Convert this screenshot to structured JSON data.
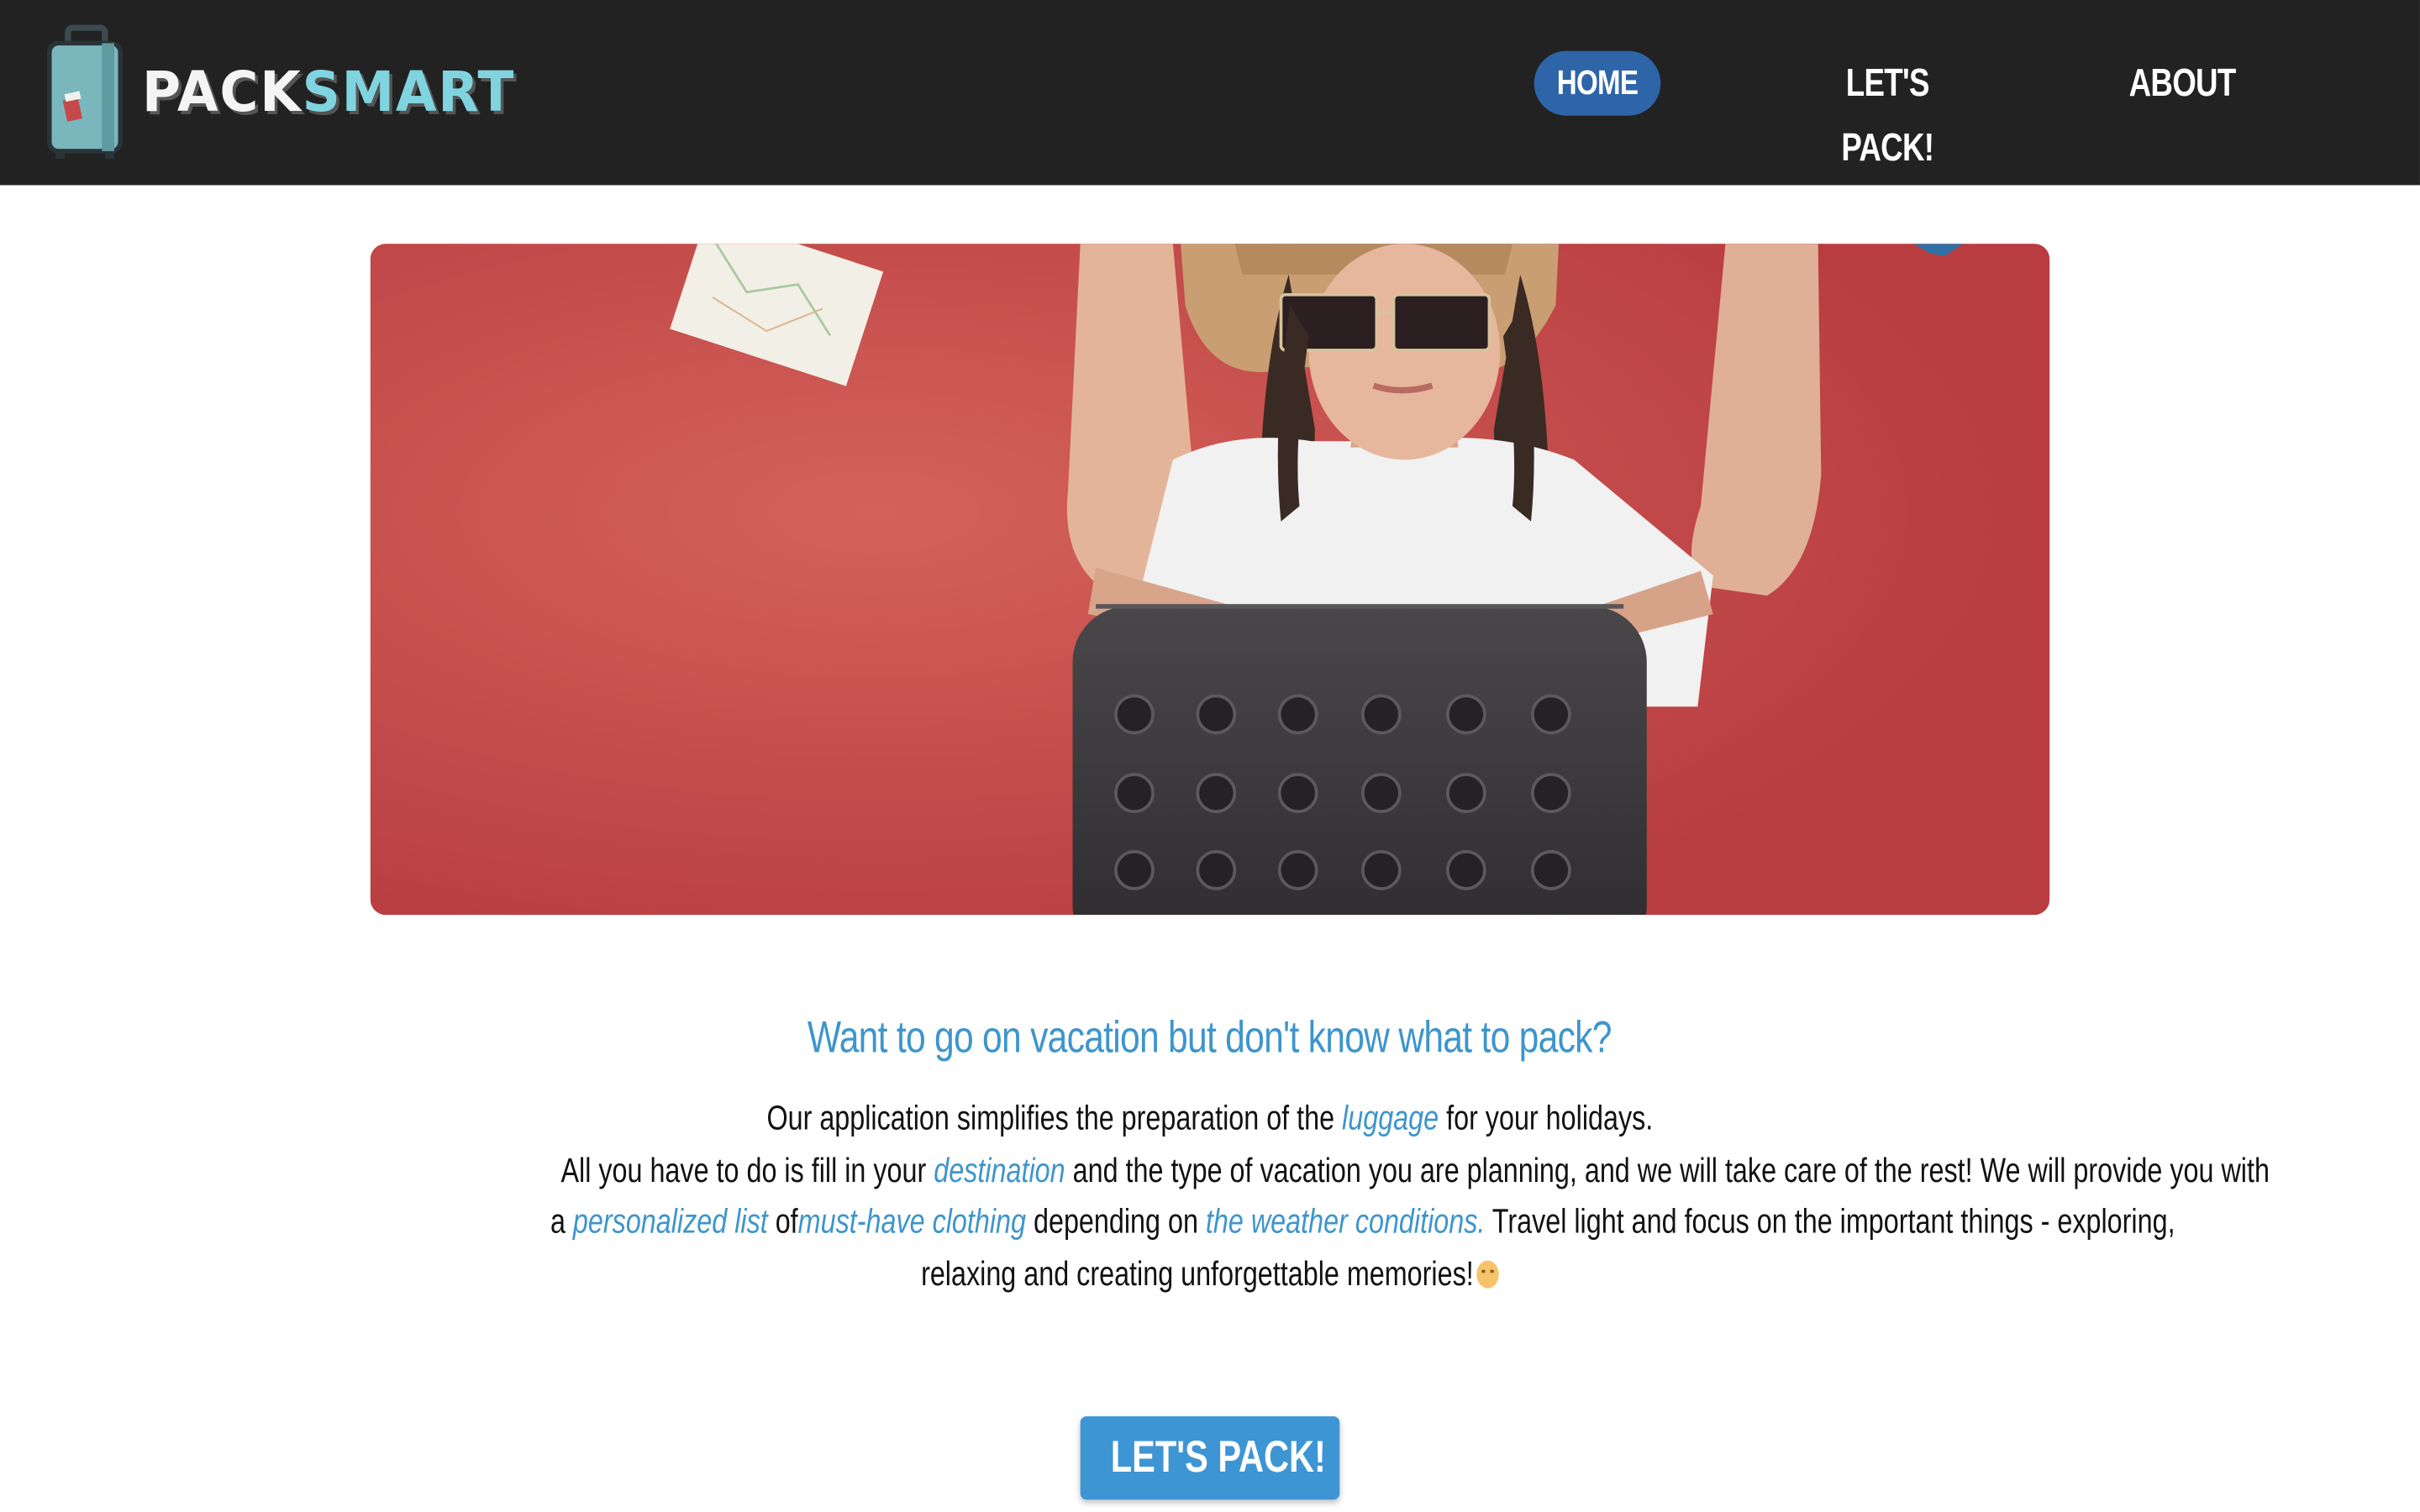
{
  "header": {
    "logo": {
      "part1": "PACK",
      "part2": "SMART",
      "icon": "suitcase-icon"
    },
    "nav": [
      {
        "label": "HOME",
        "active": true
      },
      {
        "label": "LET'S PACK!",
        "active": false
      },
      {
        "label": "ABOUT",
        "active": false
      }
    ]
  },
  "hero": {
    "image": "woman-with-sunglasses-and-suitcase-photo"
  },
  "intro": {
    "headline": "Want to go on vacation but don't know what to pack?",
    "line1": {
      "before": "Our application simplifies the preparation of the ",
      "highlight": "luggage",
      "after": " for your holidays."
    },
    "line2": {
      "before": "All you have to do is fill in your ",
      "highlight": "destination",
      "after": " and the type of vacation you are planning, and we will take care of the rest! We will provide you with"
    },
    "line3": {
      "a": "a ",
      "highlight1": "personalized list",
      "of": " of",
      "highlight2": "must-have clothing",
      "depending": " depending on ",
      "highlight3": "the weather conditions.",
      "after": " Travel light and focus on the important things - exploring,"
    },
    "line4": {
      "text": "relaxing and creating unforgettable memories!",
      "emoji": "smiling-face-icon"
    }
  },
  "cta": {
    "label": "LET'S PACK!"
  },
  "colors": {
    "header_bg": "#222222",
    "nav_active": "#2e64a8",
    "accent": "#3e95cc",
    "logo_smart": "#7fd4e0"
  }
}
